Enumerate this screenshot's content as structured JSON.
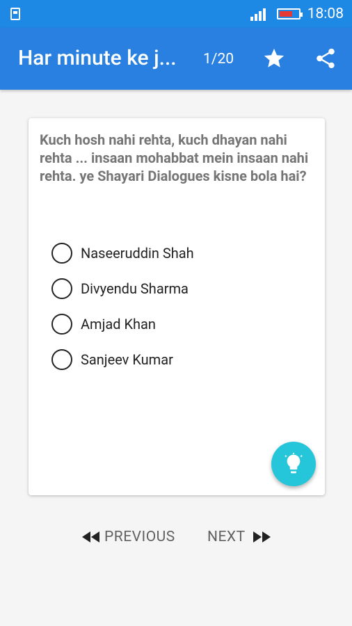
{
  "status_bar": {
    "time": "18:08",
    "icons": [
      "usb-icon",
      "signal-icon",
      "battery-icon"
    ]
  },
  "app_bar": {
    "title": "Har minute ke j...",
    "counter": "1/20",
    "actions": [
      "star-icon",
      "share-icon"
    ]
  },
  "question": {
    "text": "Kuch hosh nahi rehta, kuch dhayan nahi rehta ... insaan mohabbat mein insaan nahi rehta. ye Shayari Dialogues kisne bola hai?"
  },
  "options": [
    {
      "label": "Naseeruddin Shah"
    },
    {
      "label": "Divyendu Sharma"
    },
    {
      "label": "Amjad Khan"
    },
    {
      "label": "Sanjeev Kumar"
    }
  ],
  "hint": {
    "icon": "lightbulb-icon"
  },
  "navigation": {
    "previous_label": "PREVIOUS",
    "next_label": "NEXT"
  },
  "colors": {
    "status_bar": "#1e88e5",
    "app_bar": "#2980e0",
    "fab": "#26c6da"
  }
}
